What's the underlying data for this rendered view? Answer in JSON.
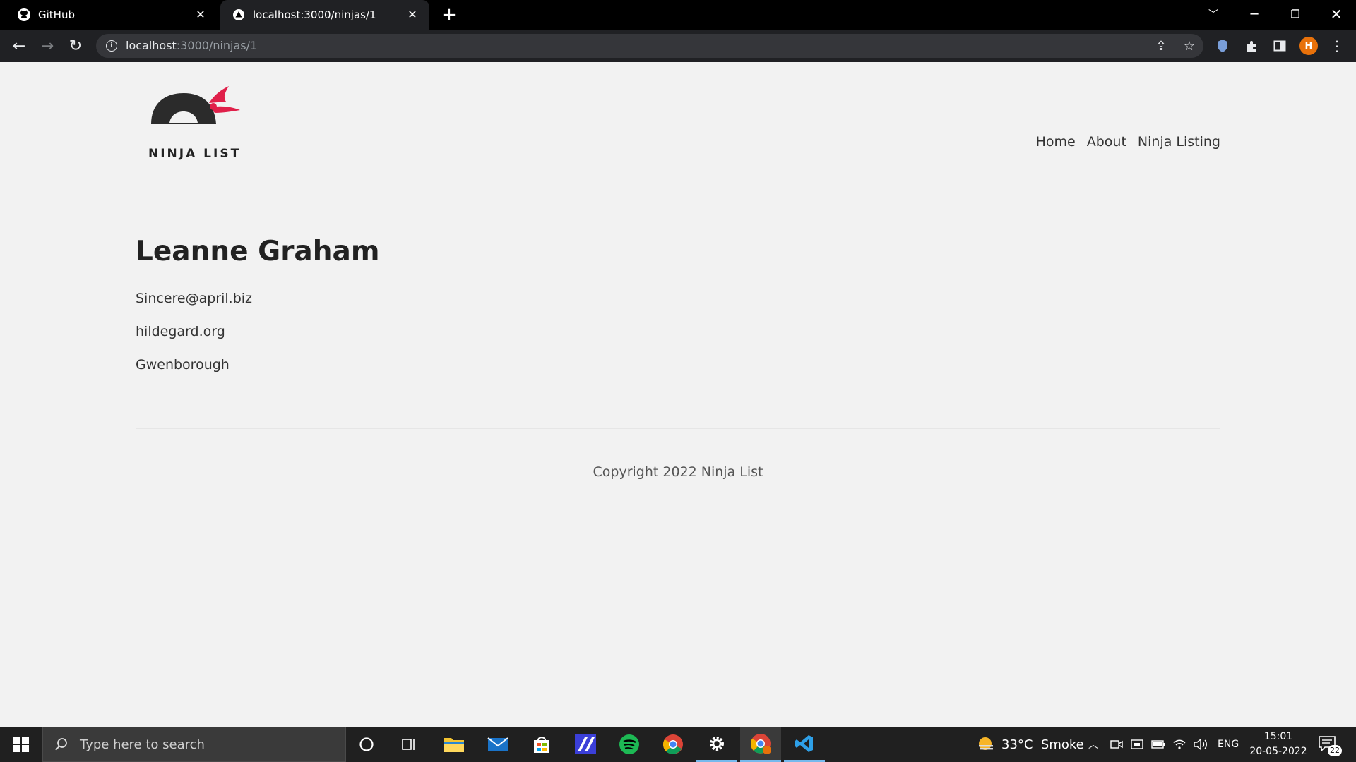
{
  "browser": {
    "tabs": [
      {
        "label": "GitHub",
        "icon": "github-icon",
        "active": false
      },
      {
        "label": "localhost:3000/ninjas/1",
        "icon": "nextjs-triangle-icon",
        "active": true
      }
    ],
    "url_host": "localhost",
    "url_rest": ":3000/ninjas/1",
    "profile_initial": "H"
  },
  "site": {
    "logo_text": "NINJA LIST",
    "nav": [
      "Home",
      "About",
      "Ninja Listing"
    ],
    "ninja": {
      "name": "Leanne Graham",
      "email": "Sincere@april.biz",
      "website": "hildegard.org",
      "city": "Gwenborough"
    },
    "footer": "Copyright 2022 Ninja List"
  },
  "taskbar": {
    "search_placeholder": "Type here to search",
    "weather": "33°C  Smoke",
    "language": "ENG",
    "time": "15:01",
    "date": "20-05-2022",
    "notification_count": "22"
  },
  "colors": {
    "page_bg": "#f2f2f2",
    "accent_red": "#e0204a",
    "chrome_dark": "#202124"
  }
}
